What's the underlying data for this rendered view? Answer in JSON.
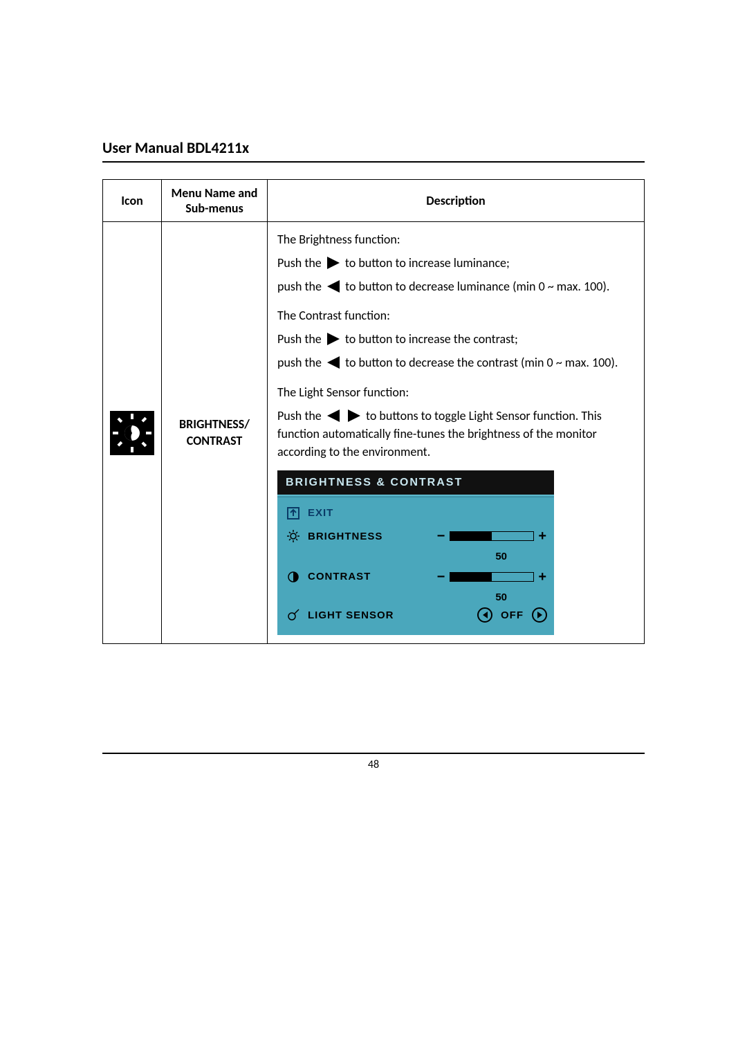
{
  "doc": {
    "title": "User Manual BDL4211x",
    "page_number": "48"
  },
  "table": {
    "headers": {
      "icon": "Icon",
      "menu": "Menu Name and Sub-menus",
      "desc": "Description"
    },
    "row": {
      "menu_name": "BRIGHTNESS/ CONTRAST",
      "desc": {
        "brightness_heading": "The Brightness function:",
        "push_the": "Push the",
        "push_the_lc": "push the",
        "increase_lum": " to button to increase luminance;",
        "decrease_lum": " to button to decrease luminance (min 0 ~ max. 100).",
        "contrast_heading": "The Contrast function:",
        "increase_con": " to button to increase the contrast;",
        "decrease_con": " to button to decrease the contrast (min 0 ~ max. 100).",
        "ls_heading": "The Light Sensor function:",
        "ls_toggle": " to buttons to toggle Light Sensor function. This function automatically fine-tunes the brightness of the monitor according to the environment."
      }
    }
  },
  "osd": {
    "title": "BRIGHTNESS & CONTRAST",
    "exit": "EXIT",
    "brightness_label": "BRIGHTNESS",
    "brightness_value": "50",
    "brightness_fill_pct": 50,
    "contrast_label": "CONTRAST",
    "contrast_value": "50",
    "contrast_fill_pct": 50,
    "light_sensor_label": "LIGHT SENSOR",
    "light_sensor_value": "OFF",
    "minus": "−",
    "plus": "+"
  }
}
